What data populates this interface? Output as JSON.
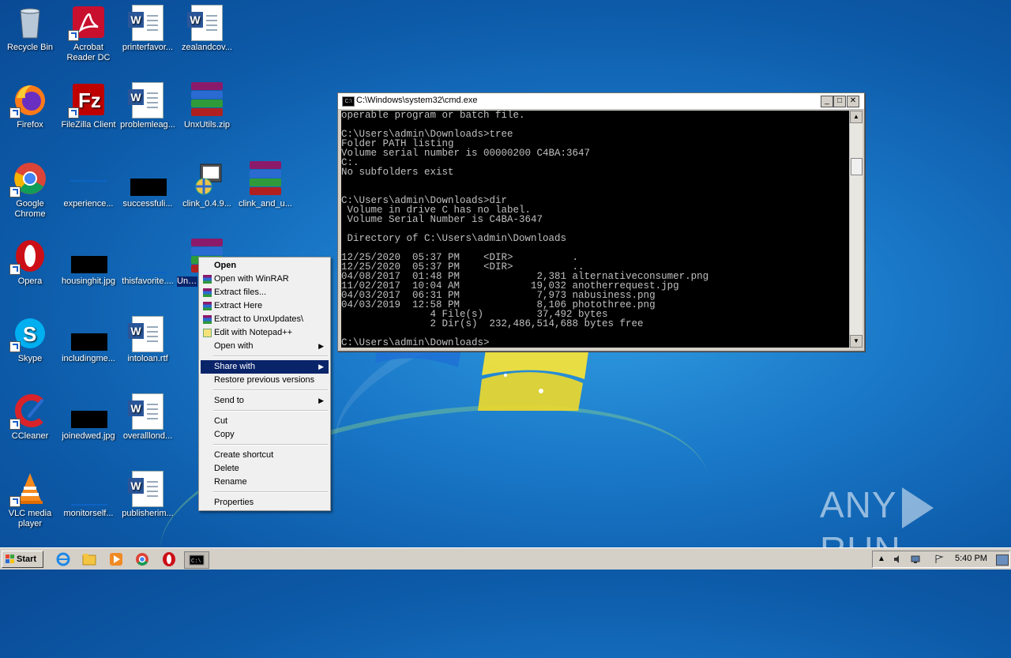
{
  "desktop": {
    "icons": [
      {
        "name": "recycle-bin",
        "label": "Recycle Bin"
      },
      {
        "name": "acrobat-reader",
        "label": "Acrobat\nReader DC"
      },
      {
        "name": "printerfavor",
        "label": "printerfavor..."
      },
      {
        "name": "zealandcov",
        "label": "zealandcov..."
      },
      {
        "name": "firefox",
        "label": "Firefox"
      },
      {
        "name": "filezilla",
        "label": "FileZilla Client"
      },
      {
        "name": "problemleag",
        "label": "problemleag..."
      },
      {
        "name": "unxutils-zip",
        "label": "UnxUtils.zip"
      },
      {
        "name": "google-chrome",
        "label": "Google\nChrome"
      },
      {
        "name": "experience",
        "label": "experience..."
      },
      {
        "name": "successfuli",
        "label": "successfuli..."
      },
      {
        "name": "clink-0-4-9",
        "label": "clink_0.4.9..."
      },
      {
        "name": "clink-and-u",
        "label": "clink_and_u..."
      },
      {
        "name": "opera",
        "label": "Opera"
      },
      {
        "name": "housinghit",
        "label": "housinghit.jpg"
      },
      {
        "name": "thisfavorite",
        "label": "thisfavorite...."
      },
      {
        "name": "unxupdates",
        "label": "UnxU"
      },
      {
        "name": "skype",
        "label": "Skype"
      },
      {
        "name": "includingme",
        "label": "includingme..."
      },
      {
        "name": "intoloan",
        "label": "intoloan.rtf"
      },
      {
        "name": "ccleaner",
        "label": "CCleaner"
      },
      {
        "name": "joinedwed",
        "label": "joinedwed.jpg"
      },
      {
        "name": "overalllond",
        "label": "overalllond..."
      },
      {
        "name": "vlc",
        "label": "VLC media\nplayer"
      },
      {
        "name": "monitorself",
        "label": "monitorself..."
      },
      {
        "name": "publisherim",
        "label": "publisherim..."
      }
    ]
  },
  "cmd": {
    "title": "C:\\Windows\\system32\\cmd.exe",
    "lines": [
      "operable program or batch file.",
      "",
      "C:\\Users\\admin\\Downloads>tree",
      "Folder PATH listing",
      "Volume serial number is 00000200 C4BA:3647",
      "C:.",
      "No subfolders exist",
      "",
      "",
      "C:\\Users\\admin\\Downloads>dir",
      " Volume in drive C has no label.",
      " Volume Serial Number is C4BA-3647",
      "",
      " Directory of C:\\Users\\admin\\Downloads",
      "",
      "12/25/2020  05:37 PM    <DIR>          .",
      "12/25/2020  05:37 PM    <DIR>          ..",
      "04/08/2017  01:48 PM             2,381 alternativeconsumer.png",
      "11/02/2017  10:04 AM            19,032 anotherrequest.jpg",
      "04/03/2017  06:31 PM             7,973 nabusiness.png",
      "04/03/2019  12:58 PM             8,106 photothree.png",
      "               4 File(s)         37,492 bytes",
      "               2 Dir(s)  232,486,514,688 bytes free",
      "",
      "C:\\Users\\admin\\Downloads>"
    ]
  },
  "context_menu": {
    "items": [
      {
        "label": "Open",
        "bold": true
      },
      {
        "label": "Open with WinRAR"
      },
      {
        "label": "Extract files..."
      },
      {
        "label": "Extract Here"
      },
      {
        "label": "Extract to UnxUpdates\\"
      },
      {
        "label": "Edit with Notepad++"
      },
      {
        "label": "Open with"
      },
      {
        "label": "Share with"
      },
      {
        "label": "Restore previous versions"
      },
      {
        "label": "Send to"
      },
      {
        "label": "Cut"
      },
      {
        "label": "Copy"
      },
      {
        "label": "Create shortcut"
      },
      {
        "label": "Delete"
      },
      {
        "label": "Rename"
      },
      {
        "label": "Properties"
      }
    ]
  },
  "taskbar": {
    "start_label": "Start",
    "clock": "5:40 PM"
  },
  "watermark": {
    "text_left": "ANY",
    "text_right": "RUN"
  },
  "colors": {
    "menu_highlight": "#0a246a",
    "desktop_blue": "#1a78c8"
  }
}
